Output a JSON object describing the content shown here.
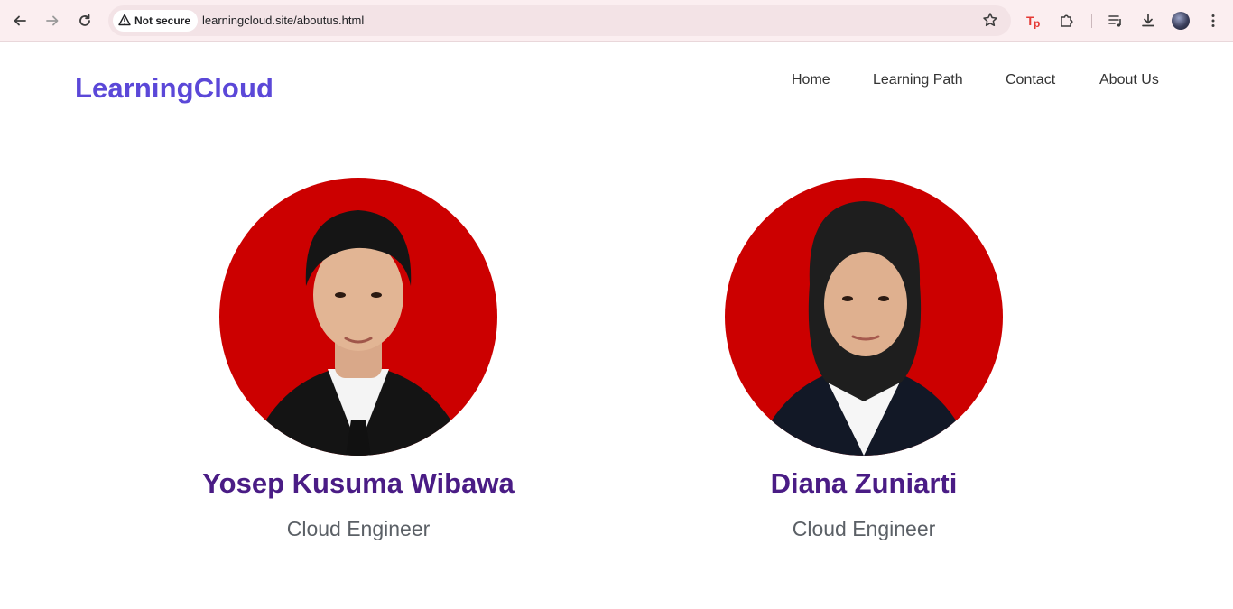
{
  "browser": {
    "security_label": "Not secure",
    "url": "learningcloud.site/aboutus.html",
    "icons": [
      "back-icon",
      "forward-icon",
      "reload-icon",
      "warning-icon",
      "star-icon",
      "tp-extension-icon",
      "puzzle-icon",
      "media-icon",
      "download-icon",
      "avatar",
      "kebab-menu-icon"
    ]
  },
  "header": {
    "brand": "LearningCloud",
    "nav": [
      "Home",
      "Learning Path",
      "Contact",
      "About Us"
    ]
  },
  "team": [
    {
      "name": "Yosep Kusuma Wibawa",
      "role": "Cloud Engineer"
    },
    {
      "name": "Diana Zuniarti",
      "role": "Cloud Engineer"
    }
  ],
  "colors": {
    "brand": "#5b48d8",
    "name": "#4a1c85",
    "photo_bg": "#cc0000"
  }
}
